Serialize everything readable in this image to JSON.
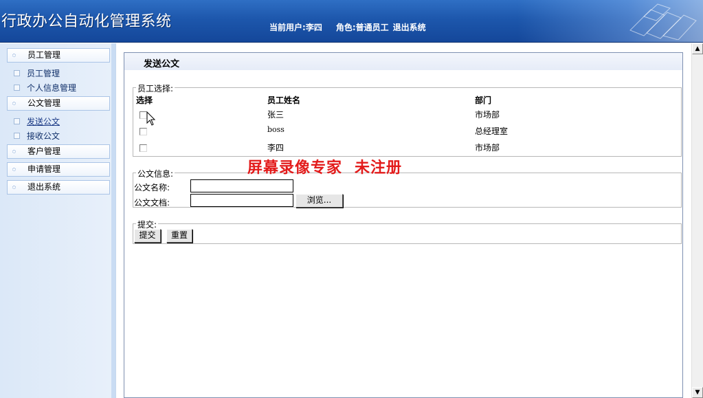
{
  "header": {
    "app_title": "行政办公自动化管理系统",
    "current_user_label": "当前用户:",
    "current_user": "李四",
    "role_label": "角色:",
    "role": "普通员工",
    "logout": "退出系统"
  },
  "sidebar": {
    "groups": [
      {
        "label": "员工管理"
      },
      {
        "label": "公文管理"
      },
      {
        "label": "客户管理"
      },
      {
        "label": "申请管理"
      },
      {
        "label": "退出系统"
      }
    ],
    "items": [
      {
        "label": "员工管理"
      },
      {
        "label": "个人信息管理"
      },
      {
        "label": "发送公文"
      },
      {
        "label": "接收公文"
      }
    ]
  },
  "main": {
    "title": "发送公文",
    "employee_section": {
      "legend": "员工选择:",
      "headers": {
        "select": "选择",
        "name": "员工姓名",
        "dept": "部门"
      },
      "rows": [
        {
          "name": "张三",
          "dept": "市场部",
          "checked": false
        },
        {
          "name": "boss",
          "dept": "总经理室",
          "checked": false
        },
        {
          "name": "李四",
          "dept": "市场部",
          "checked": false
        }
      ]
    },
    "doc_section": {
      "legend": "公文信息:",
      "name_label": "公文名称:",
      "name_value": "",
      "file_label": "公文文档:",
      "file_value": "",
      "browse": "浏览..."
    },
    "submit_section": {
      "legend": "提交:",
      "submit": "提交",
      "reset": "重置"
    }
  },
  "watermark": {
    "part1": "屏幕录像专家",
    "part2": "未注册"
  },
  "colors": {
    "header_blue": "#1d57ac",
    "watermark_red": "#e31b1b",
    "sidebar_bg": "#dbe8f8"
  }
}
